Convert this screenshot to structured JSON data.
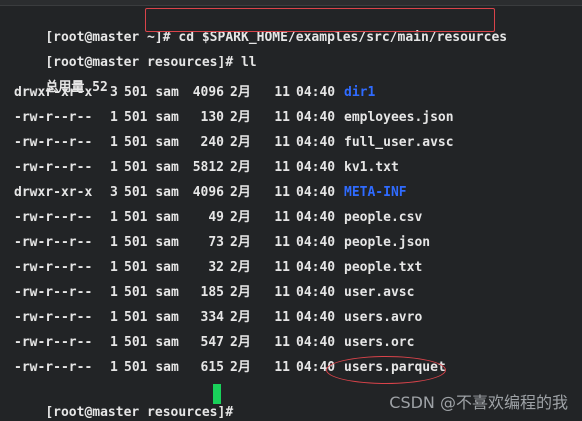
{
  "terminal": {
    "lines": [
      {
        "prompt": "[root@master ~]# ",
        "command": "cd $SPARK_HOME/examples/src/main/resources"
      },
      {
        "prompt": "[root@master resources]# ",
        "command": "ll"
      },
      {
        "text": "总用量 52"
      }
    ],
    "listing": [
      {
        "perm": "drwxr-xr-x",
        "links": "3",
        "uid": "501",
        "group": "sam",
        "size": "4096",
        "month": "2月",
        "day": "11",
        "time": "04:40",
        "name": "dir1",
        "type": "dir"
      },
      {
        "perm": "-rw-r--r--",
        "links": "1",
        "uid": "501",
        "group": "sam",
        "size": "130",
        "month": "2月",
        "day": "11",
        "time": "04:40",
        "name": "employees.json",
        "type": "file"
      },
      {
        "perm": "-rw-r--r--",
        "links": "1",
        "uid": "501",
        "group": "sam",
        "size": "240",
        "month": "2月",
        "day": "11",
        "time": "04:40",
        "name": "full_user.avsc",
        "type": "file"
      },
      {
        "perm": "-rw-r--r--",
        "links": "1",
        "uid": "501",
        "group": "sam",
        "size": "5812",
        "month": "2月",
        "day": "11",
        "time": "04:40",
        "name": "kv1.txt",
        "type": "file"
      },
      {
        "perm": "drwxr-xr-x",
        "links": "3",
        "uid": "501",
        "group": "sam",
        "size": "4096",
        "month": "2月",
        "day": "11",
        "time": "04:40",
        "name": "META-INF",
        "type": "dir"
      },
      {
        "perm": "-rw-r--r--",
        "links": "1",
        "uid": "501",
        "group": "sam",
        "size": "49",
        "month": "2月",
        "day": "11",
        "time": "04:40",
        "name": "people.csv",
        "type": "file"
      },
      {
        "perm": "-rw-r--r--",
        "links": "1",
        "uid": "501",
        "group": "sam",
        "size": "73",
        "month": "2月",
        "day": "11",
        "time": "04:40",
        "name": "people.json",
        "type": "file"
      },
      {
        "perm": "-rw-r--r--",
        "links": "1",
        "uid": "501",
        "group": "sam",
        "size": "32",
        "month": "2月",
        "day": "11",
        "time": "04:40",
        "name": "people.txt",
        "type": "file"
      },
      {
        "perm": "-rw-r--r--",
        "links": "1",
        "uid": "501",
        "group": "sam",
        "size": "185",
        "month": "2月",
        "day": "11",
        "time": "04:40",
        "name": "user.avsc",
        "type": "file"
      },
      {
        "perm": "-rw-r--r--",
        "links": "1",
        "uid": "501",
        "group": "sam",
        "size": "334",
        "month": "2月",
        "day": "11",
        "time": "04:40",
        "name": "users.avro",
        "type": "file"
      },
      {
        "perm": "-rw-r--r--",
        "links": "1",
        "uid": "501",
        "group": "sam",
        "size": "547",
        "month": "2月",
        "day": "11",
        "time": "04:40",
        "name": "users.orc",
        "type": "file"
      },
      {
        "perm": "-rw-r--r--",
        "links": "1",
        "uid": "501",
        "group": "sam",
        "size": "615",
        "month": "2月",
        "day": "11",
        "time": "04:40",
        "name": "users.parquet",
        "type": "file"
      }
    ],
    "final_prompt": "[root@master resources]# "
  },
  "watermark": "CSDN @不喜欢编程的我",
  "colors": {
    "background": "#222426",
    "text": "#e6e6e6",
    "directory": "#2f6bff",
    "highlight": "#d9434a",
    "cursor": "#19d15a"
  }
}
